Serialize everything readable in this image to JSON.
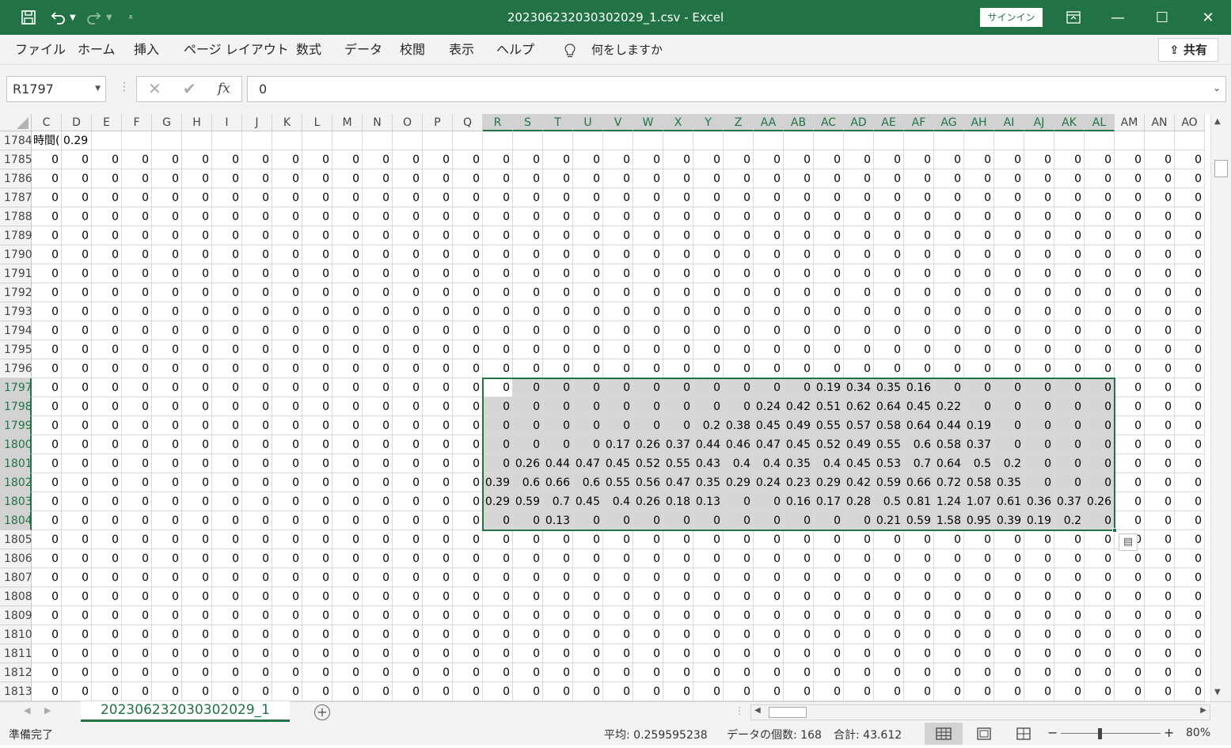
{
  "window": {
    "title": "202306232030302029_1.csv  -  Excel",
    "signin_label": "サインイン",
    "minimize": "—",
    "maximize": "☐",
    "close": "✕"
  },
  "ribbon": {
    "tabs": [
      "ファイル",
      "ホーム",
      "挿入",
      "ページ レイアウト",
      "数式",
      "データ",
      "校閲",
      "表示",
      "ヘルプ"
    ],
    "tell_me": "何をしますか",
    "share_label": "共有"
  },
  "formula_bar": {
    "name_box": "R1797",
    "fx_label": "fx",
    "formula": "0"
  },
  "grid": {
    "columns": [
      "C",
      "D",
      "E",
      "F",
      "G",
      "H",
      "I",
      "J",
      "K",
      "L",
      "M",
      "N",
      "O",
      "P",
      "Q",
      "R",
      "S",
      "T",
      "U",
      "V",
      "W",
      "X",
      "Y",
      "Z",
      "AA",
      "AB",
      "AC",
      "AD",
      "AE",
      "AF",
      "AG",
      "AH",
      "AI",
      "AJ",
      "AK",
      "AL",
      "AM",
      "AN",
      "AO"
    ],
    "selected_columns_start": "R",
    "selected_columns_end": "AL",
    "rows": [
      {
        "n": "1784",
        "c": "時間(",
        "d": "0.29"
      },
      {
        "n": "1785"
      },
      {
        "n": "1786"
      },
      {
        "n": "1787"
      },
      {
        "n": "1788"
      },
      {
        "n": "1789"
      },
      {
        "n": "1790"
      },
      {
        "n": "1791"
      },
      {
        "n": "1792"
      },
      {
        "n": "1793"
      },
      {
        "n": "1794"
      },
      {
        "n": "1795"
      },
      {
        "n": "1796"
      },
      {
        "n": "1797",
        "sel": [
          "0",
          "0",
          "0",
          "0",
          "0",
          "0",
          "0",
          "0",
          "0",
          "0",
          "0",
          "0.19",
          "0.34",
          "0.35",
          "0.16",
          "0",
          "0",
          "0",
          "0",
          "0",
          "0"
        ]
      },
      {
        "n": "1798",
        "sel": [
          "0",
          "0",
          "0",
          "0",
          "0",
          "0",
          "0",
          "0",
          "0",
          "0.24",
          "0.42",
          "0.51",
          "0.62",
          "0.64",
          "0.45",
          "0.22",
          "0",
          "0",
          "0",
          "0",
          "0"
        ]
      },
      {
        "n": "1799",
        "sel": [
          "0",
          "0",
          "0",
          "0",
          "0",
          "0",
          "0",
          "0.2",
          "0.38",
          "0.45",
          "0.49",
          "0.55",
          "0.57",
          "0.58",
          "0.64",
          "0.44",
          "0.19",
          "0",
          "0",
          "0",
          "0"
        ]
      },
      {
        "n": "1800",
        "sel": [
          "0",
          "0",
          "0",
          "0",
          "0.17",
          "0.26",
          "0.37",
          "0.44",
          "0.46",
          "0.47",
          "0.45",
          "0.52",
          "0.49",
          "0.55",
          "0.6",
          "0.58",
          "0.37",
          "0",
          "0",
          "0",
          "0"
        ]
      },
      {
        "n": "1801",
        "sel": [
          "0",
          "0.26",
          "0.44",
          "0.47",
          "0.45",
          "0.52",
          "0.55",
          "0.43",
          "0.4",
          "0.4",
          "0.35",
          "0.4",
          "0.45",
          "0.53",
          "0.7",
          "0.64",
          "0.5",
          "0.2",
          "0",
          "0",
          "0"
        ]
      },
      {
        "n": "1802",
        "sel": [
          "0.39",
          "0.6",
          "0.66",
          "0.6",
          "0.55",
          "0.56",
          "0.47",
          "0.35",
          "0.29",
          "0.24",
          "0.23",
          "0.29",
          "0.42",
          "0.59",
          "0.66",
          "0.72",
          "0.58",
          "0.35",
          "0",
          "0",
          "0"
        ]
      },
      {
        "n": "1803",
        "sel": [
          "0.29",
          "0.59",
          "0.7",
          "0.45",
          "0.4",
          "0.26",
          "0.18",
          "0.13",
          "0",
          "0",
          "0.16",
          "0.17",
          "0.28",
          "0.5",
          "0.81",
          "1.24",
          "1.07",
          "0.61",
          "0.36",
          "0.37",
          "0.26"
        ]
      },
      {
        "n": "1804",
        "sel": [
          "0",
          "0",
          "0.13",
          "0",
          "0",
          "0",
          "0",
          "0",
          "0",
          "0",
          "0",
          "0",
          "0",
          "0.21",
          "0.59",
          "1.58",
          "0.95",
          "0.39",
          "0.19",
          "0.2",
          "0"
        ]
      },
      {
        "n": "1805"
      },
      {
        "n": "1806"
      },
      {
        "n": "1807"
      },
      {
        "n": "1808"
      },
      {
        "n": "1809"
      },
      {
        "n": "1810"
      },
      {
        "n": "1811"
      },
      {
        "n": "1812"
      },
      {
        "n": "1813"
      }
    ],
    "default_value": "0"
  },
  "sheet": {
    "tab_name": "202306232030302029_1",
    "add_sheet": "+"
  },
  "status": {
    "ready": "準備完了",
    "average": "平均: 0.259595238",
    "count": "データの個数: 168",
    "sum": "合計: 43.612",
    "zoom": "80%"
  }
}
